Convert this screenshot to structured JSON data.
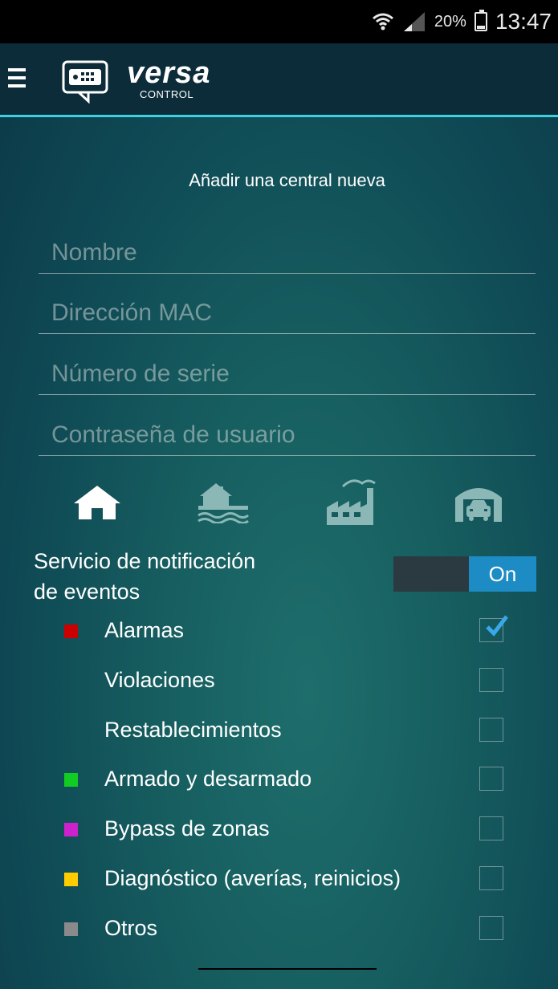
{
  "status_bar": {
    "battery": "20%",
    "time": "13:47"
  },
  "app": {
    "name": "versa",
    "subtitle": "CONTROL"
  },
  "form": {
    "title": "Añadir una central nueva",
    "fields": [
      {
        "placeholder": "Nombre",
        "value": ""
      },
      {
        "placeholder": "Dirección MAC",
        "value": ""
      },
      {
        "placeholder": "Número de serie",
        "value": ""
      },
      {
        "placeholder": "Contraseña de usuario",
        "value": ""
      }
    ]
  },
  "location_types": [
    {
      "icon": "house-icon",
      "selected": true
    },
    {
      "icon": "lake-house-icon",
      "selected": false
    },
    {
      "icon": "factory-icon",
      "selected": false
    },
    {
      "icon": "garage-icon",
      "selected": false
    }
  ],
  "notifications": {
    "label": "Servicio de notificación de eventos",
    "label_line1": "Servicio de notificación",
    "label_line2": "de eventos",
    "toggle_label": "On",
    "enabled": true,
    "events": [
      {
        "label": "Alarmas",
        "color": "#cc0000",
        "checked": true
      },
      {
        "label": "Violaciones",
        "color": "",
        "checked": false
      },
      {
        "label": "Restablecimientos",
        "color": "",
        "checked": false
      },
      {
        "label": "Armado y desarmado",
        "color": "#11cc22",
        "checked": false
      },
      {
        "label": "Bypass de zonas",
        "color": "#cc22cc",
        "checked": false
      },
      {
        "label": "Diagnóstico (averías, reinicios)",
        "color": "#ffcc00",
        "checked": false
      },
      {
        "label": "Otros",
        "color": "#8a8a8a",
        "checked": false
      }
    ]
  },
  "colors": {
    "accent": "#3fd0df",
    "toggle_on": "#1d8cc4",
    "appbar": "#0c2c3a",
    "checkmark": "#3aa8e8"
  }
}
